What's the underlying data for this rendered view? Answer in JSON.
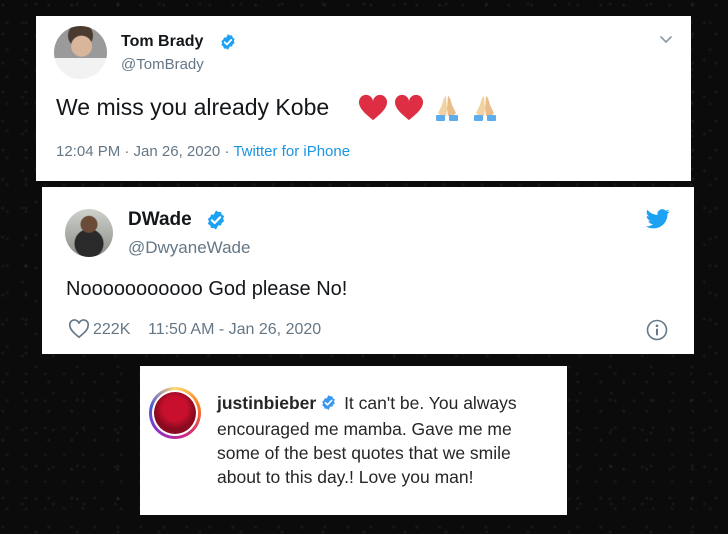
{
  "tweet1": {
    "name": "Tom Brady",
    "handle": "@TomBrady",
    "text": "We miss you already Kobe",
    "emojis": [
      "❤️",
      "❤️",
      "🙏🏼",
      "🙏🏼"
    ],
    "time": "12:04 PM · Jan 26, 2020 ·",
    "source": "Twitter for iPhone"
  },
  "tweet2": {
    "name": "DWade",
    "handle": "@DwyaneWade",
    "text": "Nooooooooooo God please No!",
    "likes": "222K",
    "time": "11:50 AM - Jan 26, 2020"
  },
  "comment": {
    "username": "justinbieber",
    "text": "It can't be. You always encouraged me mamba. Gave me me some of the best quotes that we smile about to this day.! Love you man!"
  },
  "colors": {
    "verified": "#1da1f2",
    "link": "#1b95e0",
    "heart": "#e0245e",
    "muted": "#657786"
  }
}
